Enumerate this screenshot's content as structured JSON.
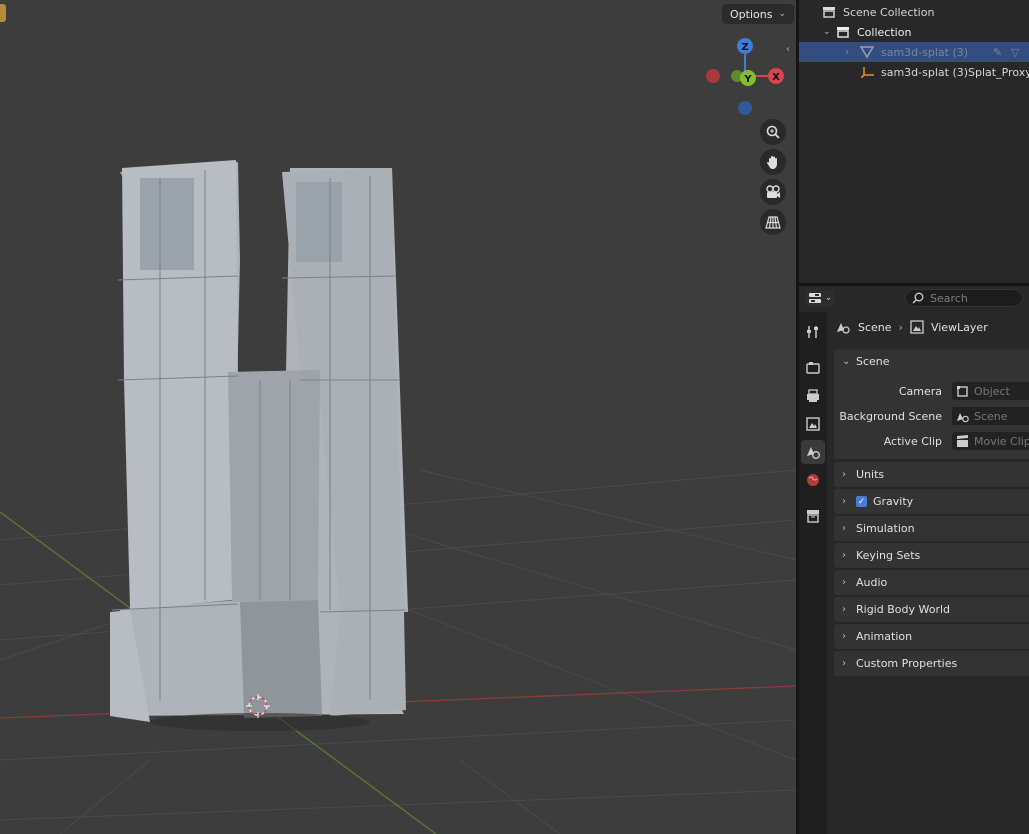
{
  "viewport": {
    "options_label": "Options",
    "gizmo": {
      "z": "Z",
      "y": "Y",
      "x": "X"
    },
    "nav_icons": [
      "zoom-icon",
      "hand-pan-icon",
      "camera-view-icon",
      "grid-ortho-icon"
    ]
  },
  "outliner": {
    "root": "Scene Collection",
    "collection": "Collection",
    "items": [
      {
        "label": "sam3d-splat (3)",
        "selected": true
      },
      {
        "label": "sam3d-splat (3)Splat_Proxy",
        "selected": false
      }
    ]
  },
  "properties": {
    "search_placeholder": "Search",
    "breadcrumb": {
      "scene": "Scene",
      "view_layer": "ViewLayer"
    },
    "scene_panel": {
      "title": "Scene",
      "rows": [
        {
          "label": "Camera",
          "value": "Object"
        },
        {
          "label": "Background Scene",
          "value": "Scene"
        },
        {
          "label": "Active Clip",
          "value": "Movie Clip"
        }
      ]
    },
    "panels": [
      "Units",
      "Gravity",
      "Simulation",
      "Keying Sets",
      "Audio",
      "Rigid Body World",
      "Animation",
      "Custom Properties"
    ],
    "gravity_checked": true
  },
  "colors": {
    "accent": "#4a7bd6",
    "selection": "#334d80",
    "x_axis": "#d9464f",
    "y_axis": "#82bd33",
    "z_axis": "#3d7ed6"
  }
}
